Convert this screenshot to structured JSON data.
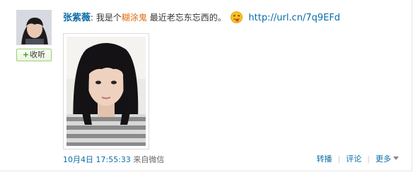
{
  "user": {
    "name": "张紫薇"
  },
  "follow": {
    "plus": "+",
    "label": "收听"
  },
  "post": {
    "separator": ":",
    "text_before": "我是个",
    "highlight": "糊涂鬼",
    "text_after": " 最近老忘东忘西的。",
    "link": "http://url.cn/7q9EFd"
  },
  "meta": {
    "date": "10月4日",
    "time": "17:55:33",
    "source": "来自微信"
  },
  "actions": {
    "repost": "转播",
    "comment": "评论",
    "more": "更多"
  }
}
